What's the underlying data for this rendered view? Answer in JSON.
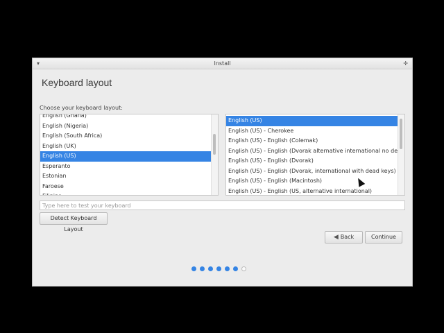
{
  "window": {
    "title": "Install",
    "menu_glyph": "▾",
    "resize_glyph": "✛"
  },
  "heading": "Keyboard layout",
  "choose_label": "Choose your keyboard layout:",
  "layouts": {
    "items": [
      "English (Ghana)",
      "English (Nigeria)",
      "English (South Africa)",
      "English (UK)",
      "English (US)",
      "Esperanto",
      "Estonian",
      "Faroese",
      "Filipino"
    ],
    "selected_index": 4
  },
  "variants": {
    "items": [
      "English (US)",
      "English (US) - Cherokee",
      "English (US) - English (Colemak)",
      "English (US) - English (Dvorak alternative international no dead keys)",
      "English (US) - English (Dvorak)",
      "English (US) - English (Dvorak, international with dead keys)",
      "English (US) - English (Macintosh)",
      "English (US) - English (US, alternative international)"
    ],
    "selected_index": 0
  },
  "test_input": {
    "placeholder": "Type here to test your keyboard",
    "value": ""
  },
  "buttons": {
    "detect": "Detect Keyboard Layout",
    "back": "Back",
    "continue": "Continue"
  },
  "progress": {
    "total_steps": 7,
    "completed_steps": 6
  },
  "colors": {
    "accent": "#3584e4"
  }
}
